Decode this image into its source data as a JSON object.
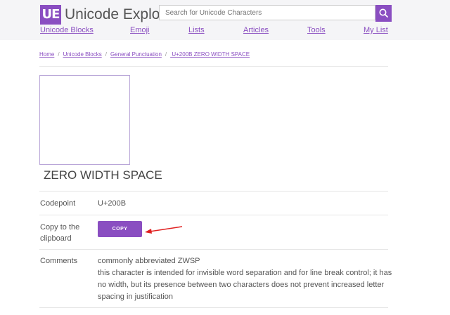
{
  "header": {
    "logo_letters": "UE",
    "logo_text": "Unicode Explorer",
    "search_placeholder": "Search for Unicode Characters"
  },
  "nav": [
    "Unicode Blocks",
    "Emoji",
    "Lists",
    "Articles",
    "Tools",
    "My List"
  ],
  "breadcrumb": [
    "Home",
    "Unicode Blocks",
    "General Punctuation",
    " U+200B ZERO WIDTH SPACE"
  ],
  "character": {
    "glyph": "​",
    "name": "ZERO WIDTH SPACE"
  },
  "details": {
    "codepoint_label": "Codepoint",
    "codepoint_value": "U+200B",
    "copy_label_line1": "Copy to the",
    "copy_label_line2": "clipboard",
    "copy_button": "COPY",
    "comments_label": "Comments",
    "comments_lines": [
      "commonly abbreviated ZWSP",
      "this character is intended for invisible word separation and for line break control; it has",
      "no width, but its presence between two characters does not prevent increased letter",
      "spacing in justification"
    ]
  },
  "colors": {
    "brand": "#8a4ec1",
    "annotation_arrow": "#e02020"
  }
}
